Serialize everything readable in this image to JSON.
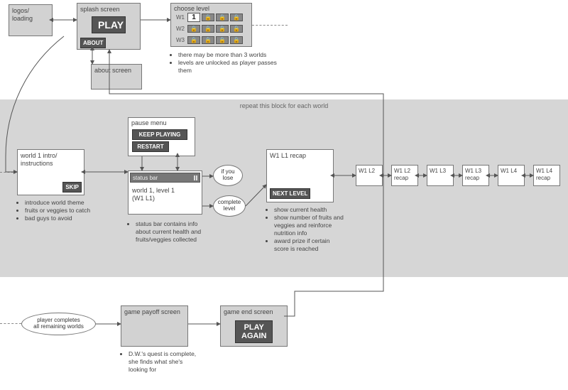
{
  "top": {
    "logos_loading": "logos/\nloading",
    "splash": {
      "title": "splash screen",
      "play": "PLAY",
      "about": "ABOUT"
    },
    "about_screen": "about screen",
    "choose_level": {
      "title": "choose level",
      "rows": [
        "W1",
        "W2",
        "W3"
      ],
      "unlocked": "1",
      "locked_glyph": "🔒"
    },
    "choose_notes": [
      "there may be more than 3 worlds",
      "levels are unlocked as player passes them"
    ]
  },
  "repeat_title": "repeat this block for each world",
  "world_intro": {
    "title": "world 1 intro/\ninstructions",
    "skip": "SKIP",
    "notes": [
      "introduce world theme",
      "fruits or veggies to catch",
      "bad guys to avoid"
    ]
  },
  "pause_menu": {
    "title": "pause menu",
    "keep": "KEEP PLAYING",
    "restart": "RESTART"
  },
  "level": {
    "status_bar": "status bar",
    "title": "world 1, level 1\n(W1 L1)",
    "notes": [
      "status bar contains info about current health and fruits/veggies collected"
    ]
  },
  "bubbles": {
    "lose": "if you\nlose",
    "complete": "complete\nlevel"
  },
  "recap": {
    "title": "W1 L1 recap",
    "next": "NEXT LEVEL",
    "notes": [
      "show current health",
      "show number of fruits and veggies and reinforce nutrition info",
      "award prize if certain score is reached"
    ]
  },
  "chain": [
    "W1 L2",
    "W1 L2\nrecap",
    "W1 L3",
    "W1 L3\nrecap",
    "W1 L4",
    "W1 L4\nrecap"
  ],
  "bottom": {
    "player_completes": "player completes\nall remaining worlds",
    "payoff": {
      "title": "game payoff screen",
      "notes": [
        "D.W.'s quest is complete, she finds what she's looking for"
      ]
    },
    "end": {
      "title": "game end screen",
      "play_again": "PLAY\nAGAIN"
    }
  }
}
